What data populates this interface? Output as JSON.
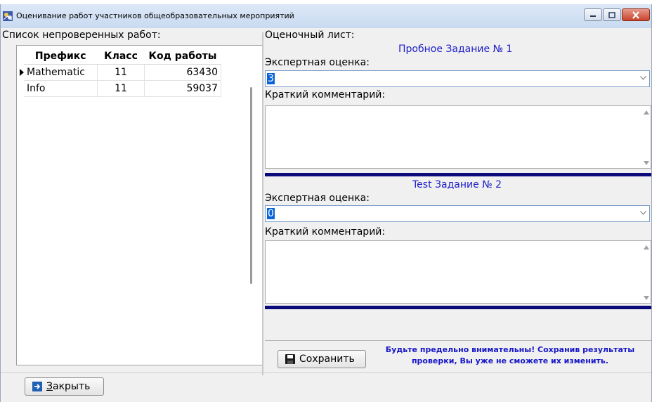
{
  "window": {
    "title": "Оценивание работ участников общеобразовательных мероприятий",
    "app_icon": "app-icon",
    "controls": {
      "minimize": "minimize-icon",
      "maximize": "maximize-icon",
      "close": "close-icon"
    }
  },
  "left_panel": {
    "header": "Список непроверенных работ:",
    "columns": [
      "Префикс",
      "Класс",
      "Код работы"
    ],
    "rows": [
      {
        "prefix": "Mathematic",
        "class": "11",
        "code": "63430",
        "current": true
      },
      {
        "prefix": "Info",
        "class": "11",
        "code": "59037",
        "current": false
      }
    ]
  },
  "right_panel": {
    "header": "Оценочный лист:",
    "tasks": [
      {
        "title": "Пробное Задание № 1",
        "grade_label": "Экспертная оценка:",
        "grade_value": "3",
        "comment_label": "Краткий комментарий:",
        "comment": ""
      },
      {
        "title": "Test Задание № 2",
        "grade_label": "Экспертная оценка:",
        "grade_value": "0",
        "comment_label": "Краткий комментарий:",
        "comment": ""
      }
    ],
    "save_button": "Сохранить",
    "warning": "Будьте предельно внимательны! Сохранив результаты проверки, Вы уже не сможете их изменить."
  },
  "footer": {
    "close_button_rest": "акрыть",
    "close_button_accel": "З"
  },
  "colors": {
    "task_title": "#2020c8",
    "separator": "#0a0a7a",
    "selection": "#0a64d8"
  }
}
